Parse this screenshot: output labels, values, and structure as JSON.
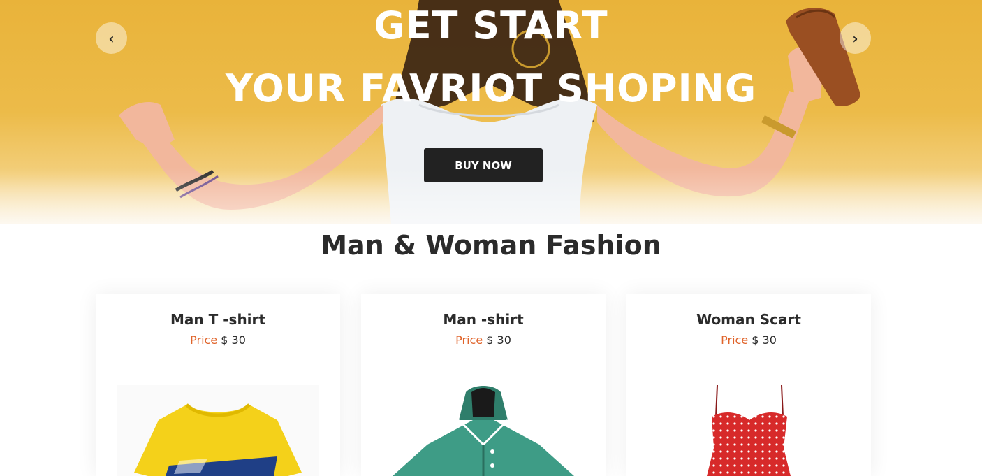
{
  "hero": {
    "title_line1": "GET START",
    "title_line2": "YOUR FAVRIOT SHOPING",
    "buy_button": "BUY NOW",
    "prev_glyph": "‹",
    "next_glyph": "›",
    "prev_icon": "chevron-left-icon",
    "next_icon": "chevron-right-icon",
    "background_color": "#ecb845"
  },
  "section": {
    "title": "Man & Woman Fashion"
  },
  "products": [
    {
      "name": "Man T -shirt",
      "price_label": "Price",
      "price_value": "$ 30",
      "image": "yellow-tshirt"
    },
    {
      "name": "Man -shirt",
      "price_label": "Price",
      "price_value": "$ 30",
      "image": "green-shirt"
    },
    {
      "name": "Woman Scart",
      "price_label": "Price",
      "price_value": "$ 30",
      "image": "red-polka-dress"
    }
  ],
  "colors": {
    "accent": "#e0642b",
    "text_dark": "#2b2b2b",
    "button_dark": "#222222"
  }
}
